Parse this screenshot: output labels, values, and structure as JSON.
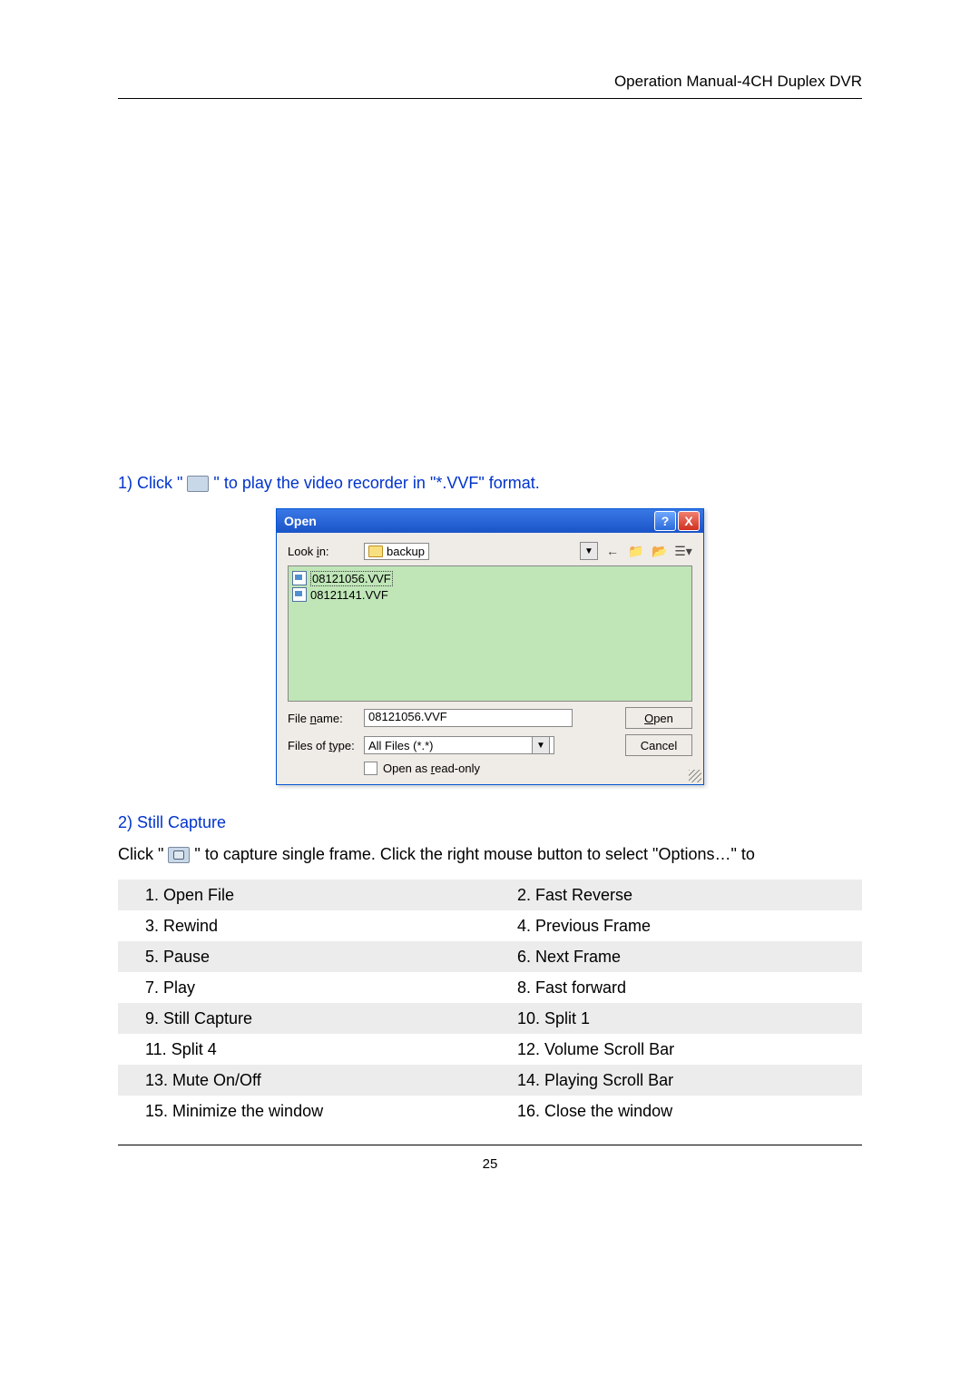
{
  "header": {
    "title": "Operation Manual-4CH Duplex DVR"
  },
  "step1": {
    "prefix": "1) Click \" ",
    "suffix": " \" to play the video recorder in \"*.VVF\" format."
  },
  "dialog": {
    "title": "Open",
    "lookin_label": "Look in:",
    "lookin_folder": "backup",
    "files": [
      "08121056.VVF",
      "08121141.VVF"
    ],
    "filename_label": "File name:",
    "filename_value": "08121056.VVF",
    "filetype_label": "Files of type:",
    "filetype_value": "All Files (*.*)",
    "open_btn_pre": "O",
    "open_btn_post": "pen",
    "cancel_btn": "Cancel",
    "readonly_pre": "Open as ",
    "readonly_u": "r",
    "readonly_post": "ead-only",
    "file_name_u": "n",
    "file_type_u": "t",
    "lookin_u": "i"
  },
  "step2": {
    "heading": "2) Still Capture"
  },
  "capture_line": {
    "prefix": "Click  \"",
    "suffix": "\"  to  capture  single  frame.  Click  the  right  mouse  button  to  select  \"Options…\"  to"
  },
  "legend": [
    [
      "1. Open File",
      "2. Fast Reverse"
    ],
    [
      "3. Rewind",
      "4. Previous Frame"
    ],
    [
      "5. Pause",
      "6. Next Frame"
    ],
    [
      "7. Play",
      "8. Fast forward"
    ],
    [
      "9. Still Capture",
      "10. Split 1"
    ],
    [
      "11. Split 4",
      "12. Volume Scroll Bar"
    ],
    [
      "13. Mute On/Off",
      "14. Playing Scroll Bar"
    ],
    [
      "15. Minimize the window",
      "16. Close the window"
    ]
  ],
  "page_number": "25"
}
